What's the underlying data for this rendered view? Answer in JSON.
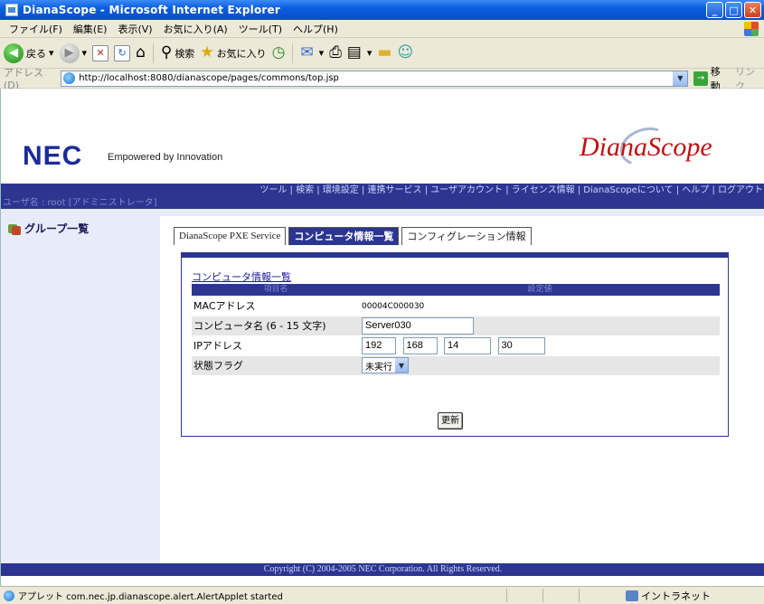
{
  "window": {
    "title": "DianaScope - Microsoft Internet Explorer"
  },
  "menu": [
    "ファイル(F)",
    "編集(E)",
    "表示(V)",
    "お気に入り(A)",
    "ツール(T)",
    "ヘルプ(H)"
  ],
  "toolbar": {
    "back_label": "戻る",
    "search_label": "検索",
    "favorites_label": "お気に入り"
  },
  "address": {
    "label": "アドレス(D)",
    "url": "http://localhost:8080/dianascope/pages/commons/top.jsp",
    "go_label": "移動",
    "links_label": "リンク"
  },
  "header": {
    "company": "NEC",
    "tagline": "Empowered by Innovation",
    "product_logo": "DianaScope"
  },
  "nav": {
    "text": "ツール | 検索 | 環境設定 | 連携サービス | ユーザアカウント | ライセンス情報 | DianaScopeについて | ヘルプ | ログアウト"
  },
  "user": {
    "text": "ユーザ名 : root [アドミニストレータ]"
  },
  "sidebar": {
    "group_label": "グループ一覧"
  },
  "tabs": [
    {
      "label": "DianaScope PXE Service",
      "active": false
    },
    {
      "label": "コンピュータ情報一覧",
      "active": true
    },
    {
      "label": "コンフィグレーション情報",
      "active": false
    }
  ],
  "form": {
    "section_title": "コンピュータ情報一覧",
    "col_item": "項目名",
    "col_value": "設定値",
    "mac_label": "MACアドレス",
    "mac_value": "00004C000030",
    "name_label": "コンピュータ名 (6 - 15 文字)",
    "name_value": "Server030",
    "ip_label": "IPアドレス",
    "ip": [
      "192",
      "168",
      "14",
      "30"
    ],
    "status_label": "状態フラグ",
    "status_value": "未実行",
    "update_button": "更新"
  },
  "footer": {
    "copyright": "Copyright (C) 2004-2005 NEC Corporation. All Rights Reserved."
  },
  "status": {
    "text": "アプレット com.nec.jp.dianascope.alert.AlertApplet started",
    "zone": "イントラネット"
  }
}
